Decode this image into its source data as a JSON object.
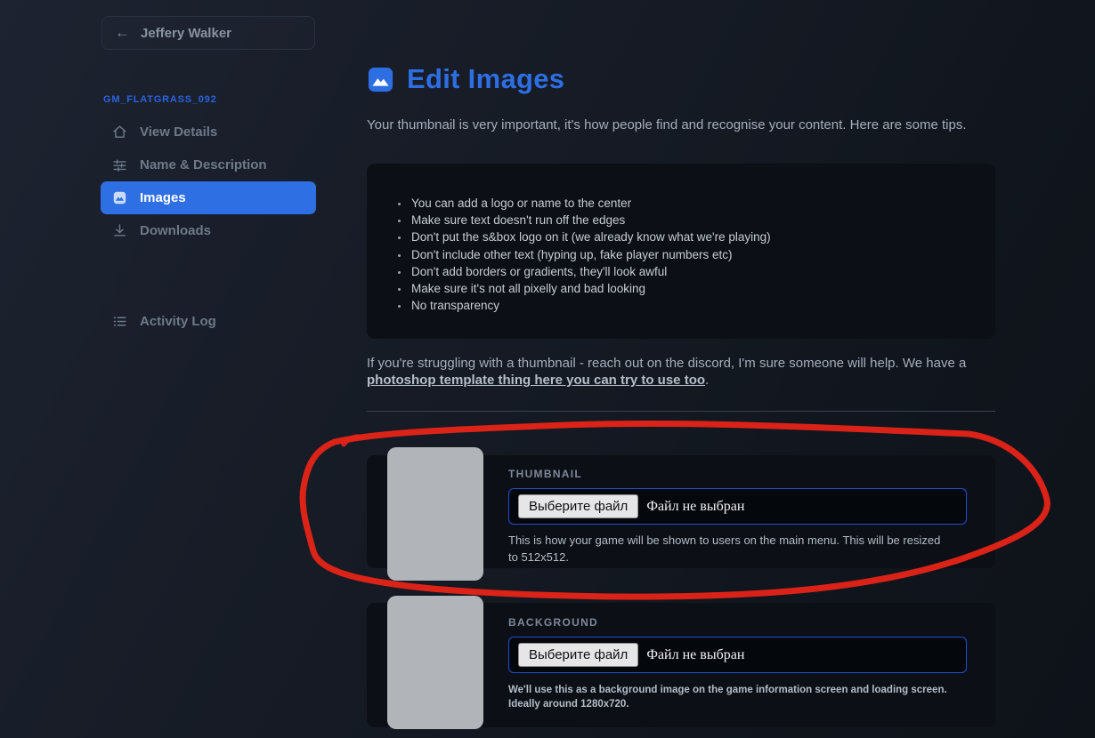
{
  "sidebar": {
    "back_button": {
      "label": "Jeffery Walker",
      "icon": "arrow-left-icon"
    },
    "project_label": "GM_FLATGRASS_092",
    "items": [
      {
        "label": "View Details",
        "icon": "home-icon",
        "active": false
      },
      {
        "label": "Name & Description",
        "icon": "sliders-icon",
        "active": false
      },
      {
        "label": "Images",
        "icon": "image-icon",
        "active": true
      },
      {
        "label": "Downloads",
        "icon": "download-icon",
        "active": false
      }
    ],
    "footer_items": [
      {
        "label": "Activity Log",
        "icon": "list-icon"
      }
    ]
  },
  "main": {
    "title": "Edit Images",
    "intro": "Your thumbnail is very important, it's how people find and recognise your content. Here are some tips.",
    "tips": [
      "You can add a logo or name to the center",
      "Make sure text doesn't run off the edges",
      "Don't put the s&box logo on it (we already know what we're playing)",
      "Don't include other text (hyping up, fake player numbers etc)",
      "Don't add borders or gradients, they'll look awful",
      "Make sure it's not all pixelly and bad looking",
      "No transparency"
    ],
    "help_prefix": "If you're struggling with a thumbnail - reach out on the discord, I'm sure someone will help. We have a ",
    "help_link": "photoshop template thing here you can try to use too",
    "help_suffix": ".",
    "sections": [
      {
        "label": "THUMBNAIL",
        "file_button": "Выберите файл",
        "file_status": "Файл не выбран",
        "description": "This is how your game will be shown to users on the main menu. This will be resized to 512x512."
      },
      {
        "label": "BACKGROUND",
        "file_button": "Выберите файл",
        "file_status": "Файл не выбран",
        "description": "We'll use this as a background image on the game information screen and loading screen. Ideally around 1280x720."
      }
    ]
  },
  "colors": {
    "accent_blue": "#2e6fe4",
    "project_blue": "#2b63e0",
    "annotation_red": "#e42318",
    "panel_bg": "#0c1016",
    "placeholder_gray": "#b1b4b9",
    "input_border_blue": "#2150cf"
  }
}
